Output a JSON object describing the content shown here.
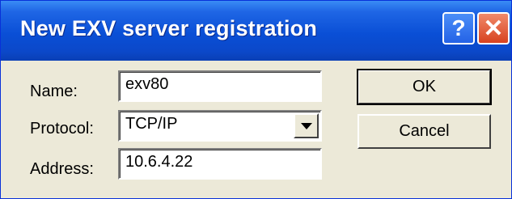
{
  "window": {
    "title": "New EXV server registration"
  },
  "titlebar_buttons": {
    "help_glyph": "?",
    "close_glyph": "✕"
  },
  "form": {
    "name": {
      "label": "Name:",
      "value": "exv80"
    },
    "protocol": {
      "label": "Protocol:",
      "value": "TCP/IP"
    },
    "address": {
      "label": "Address:",
      "value": "10.6.4.22"
    }
  },
  "buttons": {
    "ok": "OK",
    "cancel": "Cancel"
  },
  "colors": {
    "titlebar": "#0a4fd6",
    "background": "#ece9d8",
    "close": "#d7421f"
  }
}
